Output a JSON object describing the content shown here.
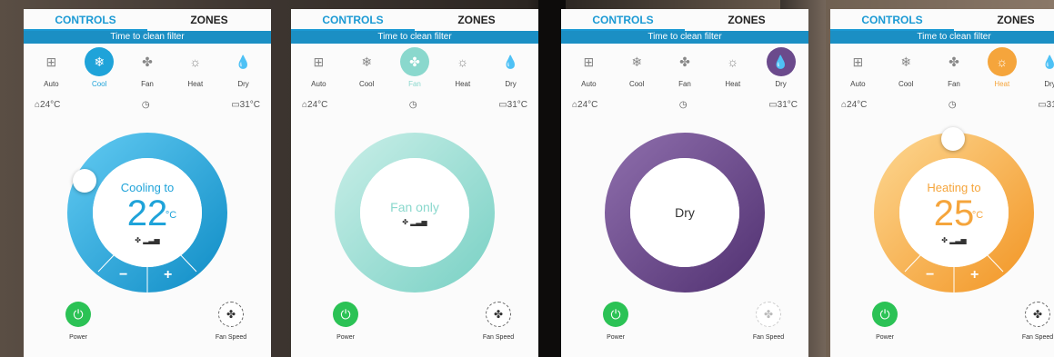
{
  "colors": {
    "cool": "#1fa3d9",
    "fan": "#8ad8cd",
    "dry": "#6b4a8c",
    "heat": "#f5a53c",
    "power": "#2bc255",
    "accent": "#1b9ad4"
  },
  "tabs": {
    "controls": "CONTROLS",
    "zones": "ZONES"
  },
  "filter_message": "Time to clean filter",
  "modes": [
    {
      "label": "Auto",
      "icon": "auto-icon"
    },
    {
      "label": "Cool",
      "icon": "snowflake-icon"
    },
    {
      "label": "Fan",
      "icon": "fan-icon"
    },
    {
      "label": "Heat",
      "icon": "sun-icon"
    },
    {
      "label": "Dry",
      "icon": "drop-icon"
    }
  ],
  "status": {
    "indoor": "24°C",
    "timer_icon": "timer-icon",
    "outdoor": "31°C"
  },
  "screens": [
    {
      "active_mode": "Cool",
      "title": "Cooling to",
      "temp": "22",
      "unit": "°C",
      "fan_text": "",
      "minus": "−",
      "plus": "+"
    },
    {
      "active_mode": "Fan",
      "title": "Fan only",
      "temp": "",
      "unit": "",
      "fan_text": ""
    },
    {
      "active_mode": "Dry",
      "title": "Dry",
      "temp": "",
      "unit": "",
      "fan_text": ""
    },
    {
      "active_mode": "Heat",
      "title": "Heating to",
      "temp": "25",
      "unit": "°C",
      "fan_text": "",
      "minus": "−",
      "plus": "+"
    }
  ],
  "bottom": {
    "power": "Power",
    "fan_speed": "Fan Speed"
  }
}
